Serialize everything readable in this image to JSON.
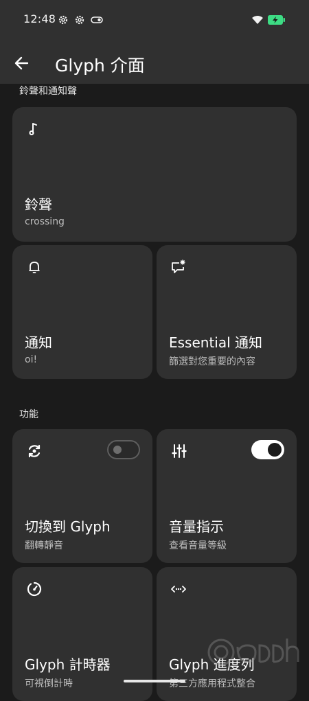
{
  "status_bar": {
    "time": "12:48",
    "icons": [
      "settings-gear-icon",
      "settings-gear-icon",
      "toggle-key-icon",
      "wifi-icon",
      "battery-charging-icon"
    ],
    "battery_color": "#3ddc84"
  },
  "app_bar": {
    "back_icon": "arrow-left-icon",
    "title": "Glyph 介面"
  },
  "sections": {
    "ringtones_header": "鈴聲和通知聲",
    "features_header": "功能"
  },
  "tiles": {
    "ringtone": {
      "icon": "music-note-icon",
      "title": "鈴聲",
      "subtitle": "crossing"
    },
    "notification": {
      "icon": "bell-icon",
      "title": "通知",
      "subtitle": "oi!"
    },
    "essential": {
      "icon": "essential-notification-icon",
      "title": "Essential 通知",
      "subtitle": "篩選對您重要的內容"
    },
    "flip_to_glyph": {
      "icon": "flip-rotate-icon",
      "title": "切換到 Glyph",
      "subtitle": "翻轉靜音",
      "toggle_on": false
    },
    "volume_indicator": {
      "icon": "sliders-icon",
      "title": "音量指示",
      "subtitle": "查看音量等級",
      "toggle_on": true
    },
    "glyph_timer": {
      "icon": "timer-icon",
      "title": "Glyph 計時器",
      "subtitle": "可視倒計時"
    },
    "glyph_progress": {
      "icon": "code-progress-icon",
      "title": "Glyph 進度列",
      "subtitle": "第三方應用程式整合"
    }
  },
  "colors": {
    "background": "#1b1b1b",
    "tile": "#303030",
    "topbar": "#303030"
  }
}
